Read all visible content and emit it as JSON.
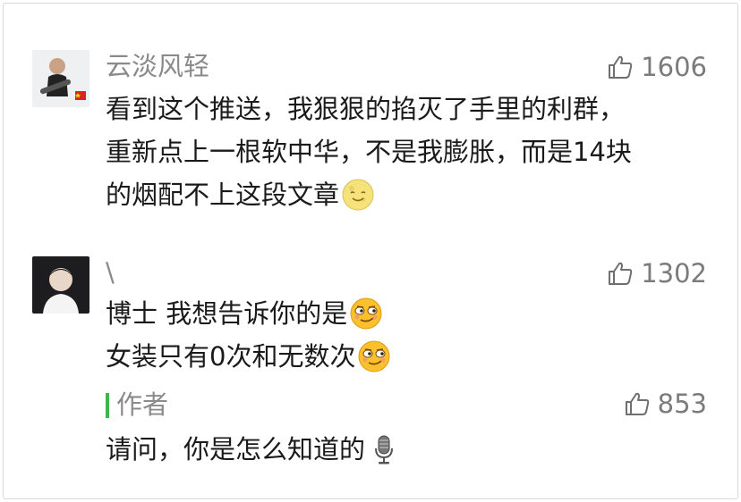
{
  "comments": [
    {
      "nickname": "云淡风轻",
      "likes": "1606",
      "lines": [
        "看到这个推送，我狠狠的掐灭了手里的利群，",
        "重新点上一根软中华，不是我膨胀，而是14块",
        "的烟配不上这段文章"
      ],
      "line3_emoji": "moon-smile-emoji"
    },
    {
      "nickname": "\\",
      "likes": "1302",
      "lines": [
        "博士 我想告诉你的是",
        "女装只有0次和无数次"
      ],
      "line_emoji": "smirk-emoji",
      "reply": {
        "label": "作者",
        "likes": "853",
        "text": "请问，你是怎么知道的",
        "emoji": "microphone-emoji"
      }
    }
  ],
  "colors": {
    "accent": "#3fb64a",
    "meta_text": "#8a8a8a",
    "like_text": "#7b7b7b"
  }
}
